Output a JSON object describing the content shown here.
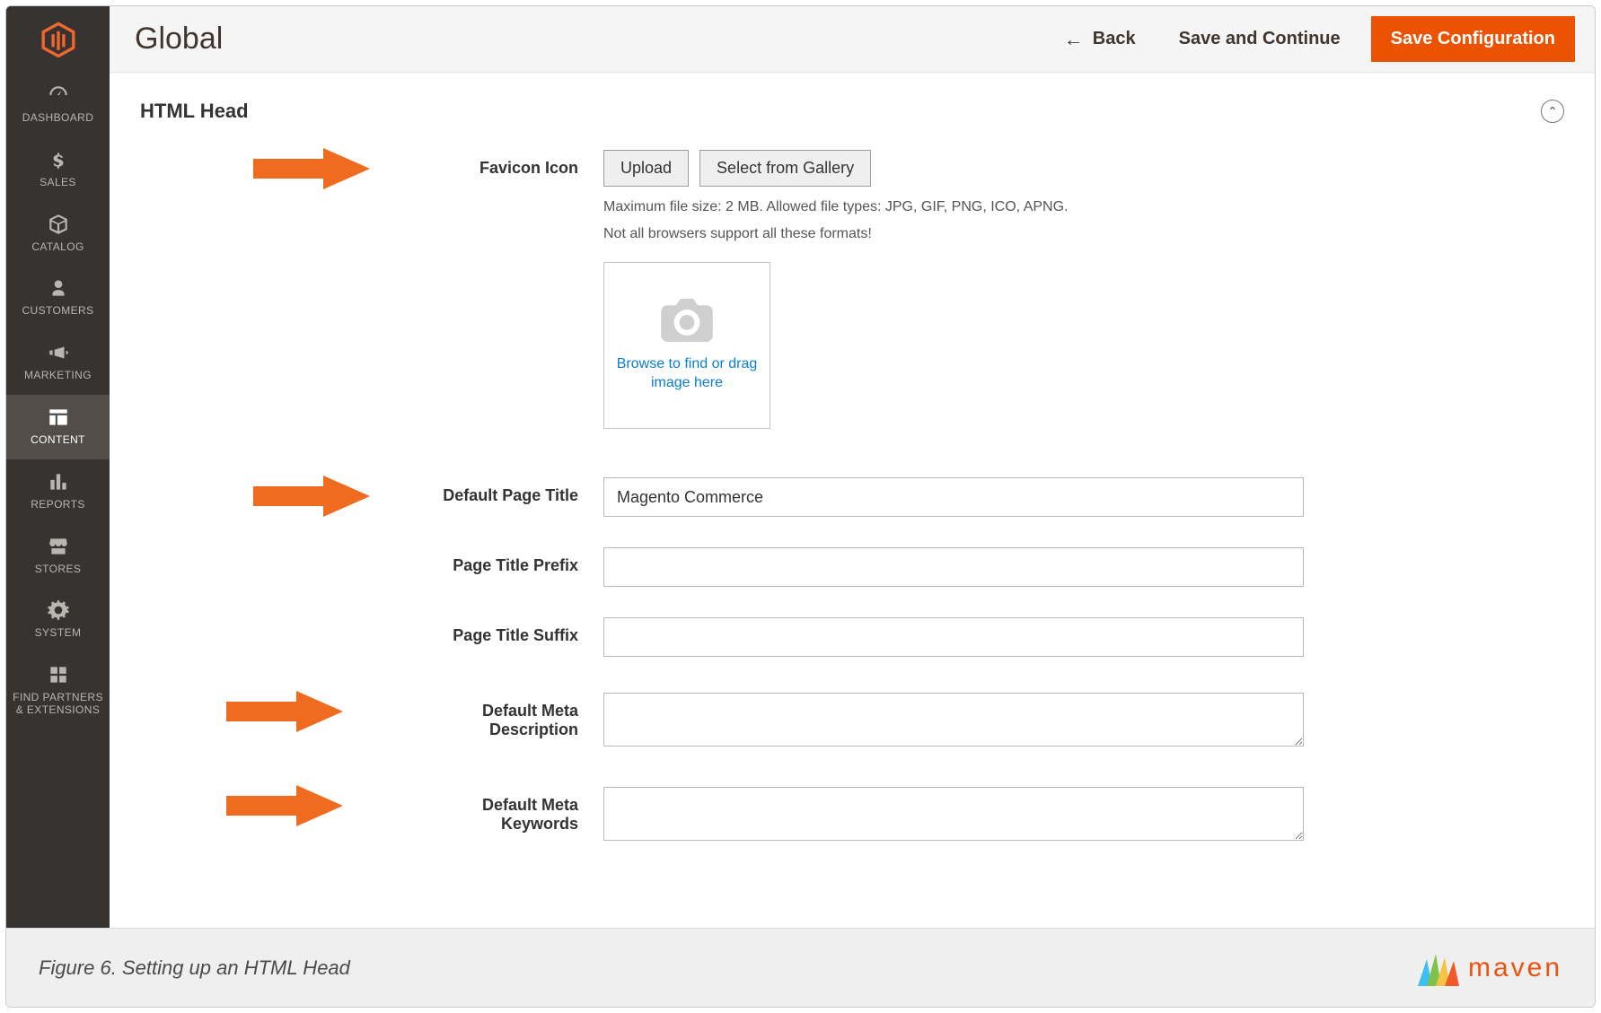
{
  "header": {
    "page_title": "Global",
    "back_label": "Back",
    "save_continue_label": "Save and Continue",
    "save_config_label": "Save Configuration"
  },
  "sidebar": {
    "items": [
      {
        "label": "DASHBOARD"
      },
      {
        "label": "SALES"
      },
      {
        "label": "CATALOG"
      },
      {
        "label": "CUSTOMERS"
      },
      {
        "label": "MARKETING"
      },
      {
        "label": "CONTENT"
      },
      {
        "label": "REPORTS"
      },
      {
        "label": "STORES"
      },
      {
        "label": "SYSTEM"
      },
      {
        "label": "FIND PARTNERS & EXTENSIONS"
      }
    ]
  },
  "section": {
    "title": "HTML Head"
  },
  "favicon": {
    "label": "Favicon Icon",
    "upload_btn": "Upload",
    "gallery_btn": "Select from Gallery",
    "hint1": "Maximum file size: 2 MB. Allowed file types: JPG, GIF, PNG, ICO, APNG.",
    "hint2": "Not all browsers support all these formats!",
    "dropzone_text": "Browse to find or drag image here"
  },
  "fields": {
    "default_page_title": {
      "label": "Default Page Title",
      "value": "Magento Commerce"
    },
    "page_title_prefix": {
      "label": "Page Title Prefix",
      "value": ""
    },
    "page_title_suffix": {
      "label": "Page Title Suffix",
      "value": ""
    },
    "default_meta_description": {
      "label": "Default Meta Description",
      "value": ""
    },
    "default_meta_keywords": {
      "label": "Default Meta Keywords",
      "value": ""
    }
  },
  "caption": {
    "text": "Figure 6. Setting up an HTML Head",
    "brand": "maven"
  },
  "colors": {
    "accent": "#eb5202",
    "link": "#0a7ed0",
    "sidebar_bg": "#373330"
  }
}
